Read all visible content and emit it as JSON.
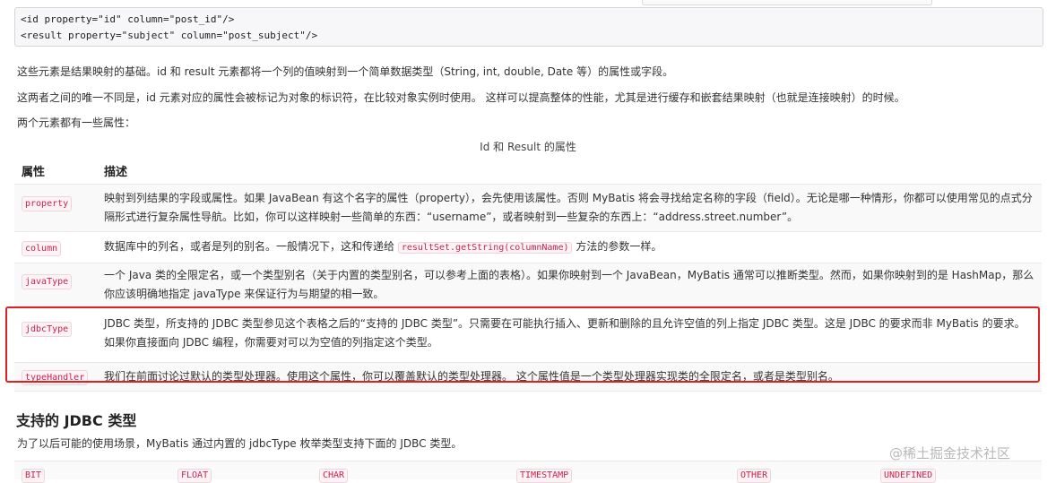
{
  "code_block": {
    "line1": "<id property=\"id\" column=\"post_id\"/>",
    "line2": "<result property=\"subject\" column=\"post_subject\"/>"
  },
  "intro": {
    "p1": "这些元素是结果映射的基础。id 和 result 元素都将一个列的值映射到一个简单数据类型（String, int, double, Date 等）的属性或字段。",
    "p2": "这两者之间的唯一不同是，id 元素对应的属性会被标记为对象的标识符，在比较对象实例时使用。 这样可以提高整体的性能，尤其是进行缓存和嵌套结果映射（也就是连接映射）的时候。",
    "p3": "两个元素都有一些属性："
  },
  "table": {
    "caption": "Id 和 Result 的属性",
    "headers": [
      "属性",
      "描述"
    ],
    "rows": [
      {
        "attr": "property",
        "desc": "映射到列结果的字段或属性。如果 JavaBean 有这个名字的属性（property），会先使用该属性。否则 MyBatis 将会寻找给定名称的字段（field）。无论是哪一种情形，你都可以使用常见的点式分隔形式进行复杂属性导航。比如，你可以这样映射一些简单的东西：“username”，或者映射到一些复杂的东西上：“address.street.number”。"
      },
      {
        "attr": "column",
        "desc_pre": "数据库中的列名，或者是列的别名。一般情况下，这和传递给",
        "desc_code": "resultSet.getString(columnName)",
        "desc_post": "方法的参数一样。"
      },
      {
        "attr": "javaType",
        "desc": "一个 Java 类的全限定名，或一个类型别名（关于内置的类型别名，可以参考上面的表格）。如果你映射到一个 JavaBean，MyBatis 通常可以推断类型。然而，如果你映射到的是 HashMap，那么你应该明确地指定 javaType 来保证行为与期望的相一致。"
      },
      {
        "attr": "jdbcType",
        "desc": "JDBC 类型，所支持的 JDBC 类型参见这个表格之后的“支持的 JDBC 类型”。只需要在可能执行插入、更新和删除的且允许空值的列上指定 JDBC 类型。这是 JDBC 的要求而非 MyBatis 的要求。如果你直接面向 JDBC 编程，你需要对可以为空值的列指定这个类型。"
      },
      {
        "attr": "typeHandler",
        "desc": "我们在前面讨论过默认的类型处理器。使用这个属性，你可以覆盖默认的类型处理器。 这个属性值是一个类型处理器实现类的全限定名，或者是类型别名。"
      }
    ]
  },
  "jdbc_section": {
    "title": "支持的 JDBC 类型",
    "desc": "为了以后可能的使用场景，MyBatis 通过内置的 jdbcType 枚举类型支持下面的 JDBC 类型。",
    "types": [
      "BIT",
      "FLOAT",
      "CHAR",
      "TIMESTAMP",
      "OTHER",
      "UNDEFINED"
    ]
  },
  "watermark": "@稀土掘金技术社区",
  "colors": {
    "highlight": "#e02020",
    "code": "#c7254e"
  }
}
